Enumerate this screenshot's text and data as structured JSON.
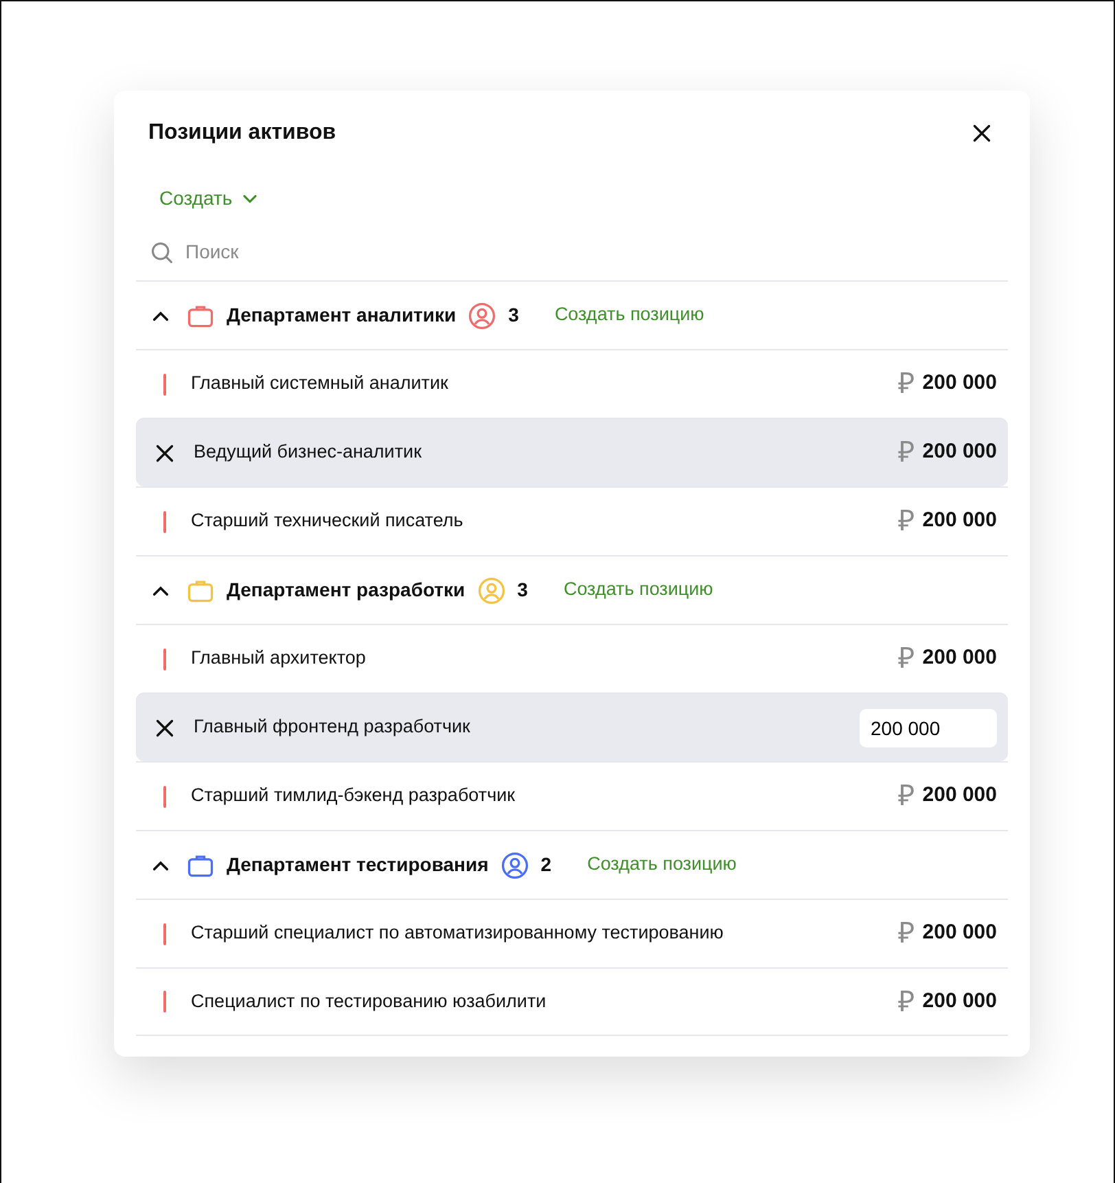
{
  "dialog": {
    "title": "Позиции активов",
    "create_menu": "Создать",
    "search": {
      "placeholder": "Поиск"
    }
  },
  "departments": [
    {
      "name": "Департамент аналитики",
      "color": "#f26b6b",
      "count": "3",
      "expanded": true,
      "create_link": "Создать позицию",
      "positions": [
        {
          "title": "Главный системный аналитик",
          "selected": false,
          "kind": "amount",
          "currency": "₽",
          "amount": "200 000"
        },
        {
          "title": "Ведущий бизнес-аналитик",
          "selected": true,
          "kind": "amount",
          "currency": "₽",
          "amount": "200 000"
        },
        {
          "title": "Старший технический писатель",
          "selected": false,
          "kind": "amount",
          "currency": "₽",
          "amount": "200 000"
        }
      ]
    },
    {
      "name": "Департамент разработки",
      "color": "#f5c344",
      "count": "3",
      "expanded": true,
      "create_link": "Создать позицию",
      "positions": [
        {
          "title": "Главный архитектор",
          "selected": false,
          "kind": "amount",
          "currency": "₽",
          "amount": "200 000"
        },
        {
          "title": "Главный фронтенд разработчик",
          "selected": true,
          "kind": "input",
          "amount": "200 000"
        },
        {
          "title": "Старший тимлид-бэкенд разработчик",
          "selected": false,
          "kind": "amount",
          "currency": "₽",
          "amount": "200 000"
        }
      ]
    },
    {
      "name": "Департамент тестирования",
      "color": "#4a6ef5",
      "count": "2",
      "expanded": true,
      "create_link": "Создать позицию",
      "positions": [
        {
          "title": "Старший специалист по автоматизированному тестированию",
          "selected": false,
          "kind": "amount",
          "currency": "₽",
          "amount": "200 000"
        },
        {
          "title": "Специалист по тестированию юзабилити",
          "selected": false,
          "kind": "amount",
          "currency": "₽",
          "amount": "200 000"
        }
      ]
    }
  ]
}
